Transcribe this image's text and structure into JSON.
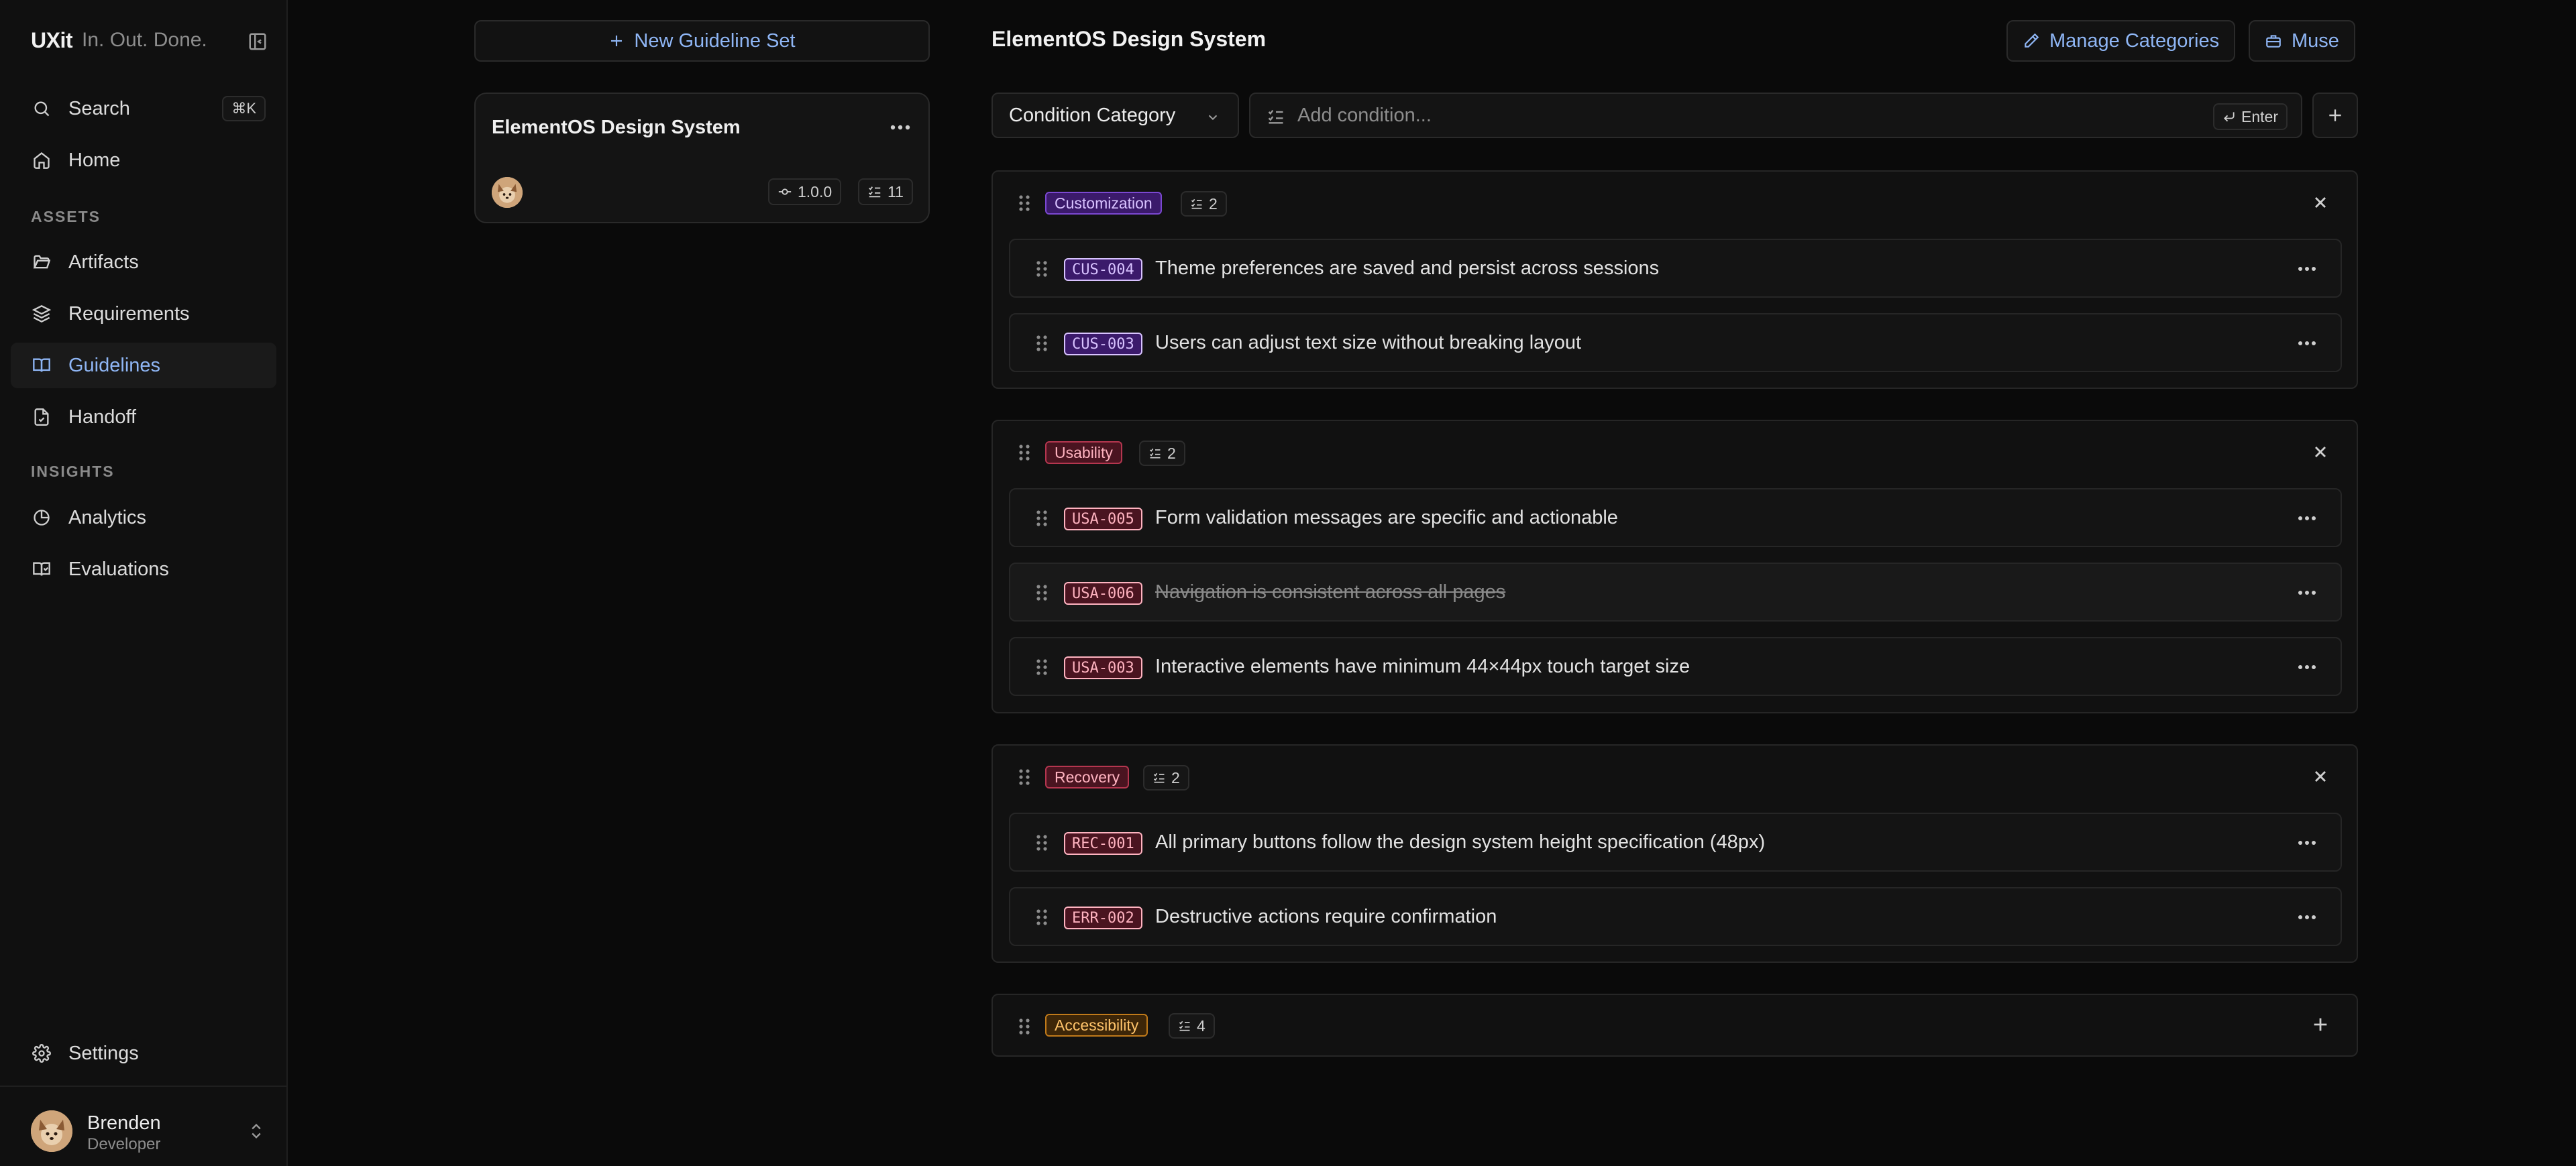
{
  "sidebar": {
    "brand": {
      "logo": "UXit",
      "tagline": "In. Out. Done."
    },
    "search": {
      "label": "Search",
      "shortcut": "⌘K"
    },
    "home": "Home",
    "sections": {
      "assets": "ASSETS",
      "insights": "INSIGHTS"
    },
    "assets": [
      {
        "label": "Artifacts",
        "icon": "folder-icon"
      },
      {
        "label": "Requirements",
        "icon": "layers-icon"
      },
      {
        "label": "Guidelines",
        "icon": "book-icon",
        "active": true
      },
      {
        "label": "Handoff",
        "icon": "file-icon"
      }
    ],
    "insights": [
      {
        "label": "Analytics",
        "icon": "pie-chart-icon"
      },
      {
        "label": "Evaluations",
        "icon": "book-open-icon"
      }
    ],
    "settings": "Settings",
    "user": {
      "name": "Brenden",
      "role": "Developer"
    }
  },
  "middle": {
    "new_set_label": "New Guideline Set",
    "sets": [
      {
        "title": "ElementOS Design System",
        "version": "1.0.0",
        "count": "11"
      }
    ]
  },
  "main": {
    "title": "ElementOS Design System",
    "manage_categories": "Manage Categories",
    "muse": "Muse",
    "condition_category": "Condition Category",
    "condition_placeholder": "Add condition...",
    "enter_label": "Enter",
    "groups": [
      {
        "category": "Customization",
        "count": "2",
        "rows": [
          {
            "id": "CUS-004",
            "text": "Theme preferences are saved and persist across sessions"
          },
          {
            "id": "CUS-003",
            "text": "Users can adjust text size without breaking layout"
          }
        ]
      },
      {
        "category": "Usability",
        "count": "2",
        "rows": [
          {
            "id": "USA-005",
            "text": "Form validation messages are specific and actionable"
          },
          {
            "id": "USA-006",
            "text": "Navigation is consistent across all pages"
          },
          {
            "id": "USA-003",
            "text": "Interactive elements have minimum 44×44px touch target size"
          }
        ]
      },
      {
        "category": "Recovery",
        "count": "2",
        "rows": [
          {
            "id": "REC-001",
            "text": "All primary buttons follow the design system height specification (48px)"
          },
          {
            "id": "ERR-002",
            "text": "Destructive actions require confirmation"
          }
        ]
      },
      {
        "category": "Accessibility",
        "count": "4",
        "rows": []
      }
    ]
  },
  "colors": {
    "accent": "#8fb6f5",
    "tag_purple": "#7b48d1",
    "tag_red": "#b4364f",
    "tag_amber": "#c07a1a"
  }
}
